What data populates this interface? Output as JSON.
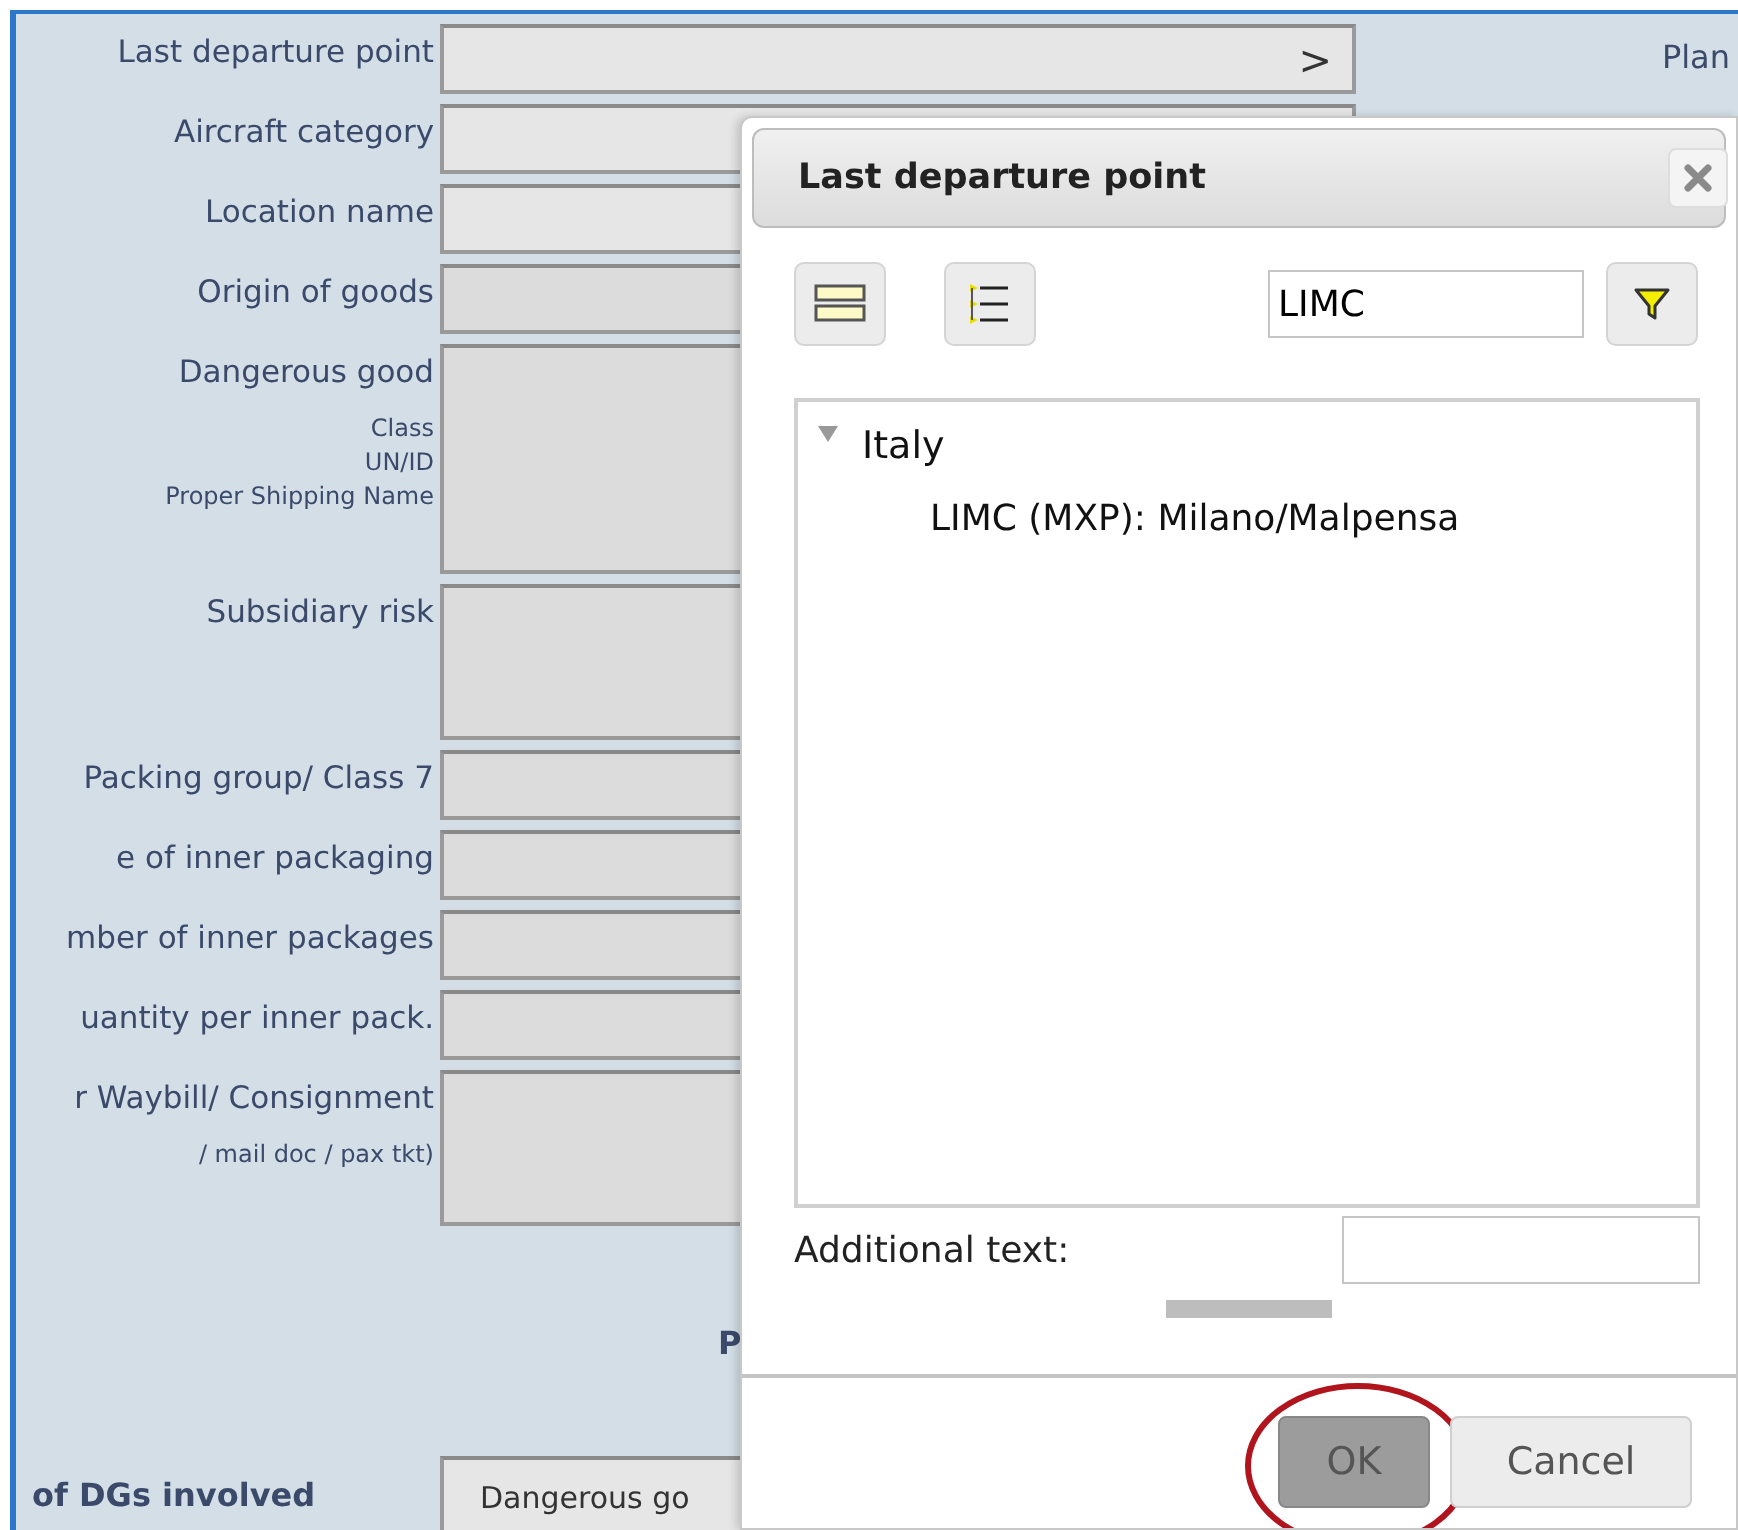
{
  "form": {
    "right_label": "Plan",
    "fields": [
      {
        "label": "Last departure point",
        "kind": "single",
        "button": ">"
      },
      {
        "label": "Aircraft category",
        "kind": "single"
      },
      {
        "label": "Location name",
        "kind": "single"
      },
      {
        "label": "Origin of goods",
        "kind": "single"
      },
      {
        "label": "Dangerous good",
        "kind": "tall",
        "sublabels": [
          "Class",
          "UN/ID",
          "Proper Shipping Name"
        ]
      },
      {
        "label": "Subsidiary risk",
        "kind": "medium"
      },
      {
        "label": "Packing group/ Class 7",
        "kind": "single"
      },
      {
        "label": "e of inner packaging",
        "kind": "single"
      },
      {
        "label": "mber of inner packages",
        "kind": "single"
      },
      {
        "label": "uantity per inner pack.",
        "kind": "single"
      },
      {
        "label": "r Waybill/ Consignment",
        "kind": "medium",
        "sublabels": [
          "/ mail doc / pax tkt)"
        ]
      }
    ],
    "section_label": "P",
    "footer": {
      "label": "of DGs involved",
      "value": "Dangerous go"
    }
  },
  "dialog": {
    "title": "Last departure point",
    "filter": {
      "value": "LIMC"
    },
    "tree": [
      {
        "label": "Italy",
        "expanded": true,
        "children": [
          {
            "label": "LIMC (MXP): Milano/Malpensa"
          }
        ]
      }
    ],
    "additional_text": {
      "label": "Additional text:"
    },
    "buttons": [
      {
        "label": "OK",
        "circled": true
      },
      {
        "label": "Cancel",
        "circled": false
      }
    ]
  }
}
